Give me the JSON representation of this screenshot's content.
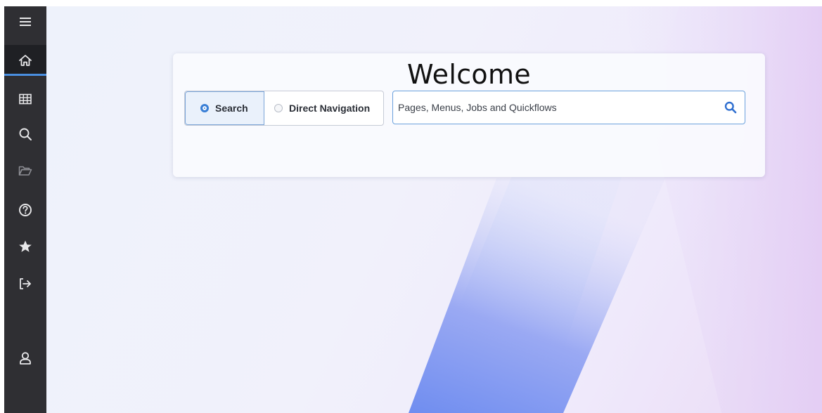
{
  "sidebar": {
    "items": [
      {
        "id": "menu",
        "icon": "hamburger-menu-icon"
      },
      {
        "id": "home",
        "icon": "home-icon",
        "active": true
      },
      {
        "id": "dashboard",
        "icon": "grid-icon"
      },
      {
        "id": "search",
        "icon": "search-icon"
      },
      {
        "id": "files",
        "icon": "folder-icon"
      },
      {
        "id": "help",
        "icon": "help-icon"
      },
      {
        "id": "favorites",
        "icon": "star-icon"
      },
      {
        "id": "sign-out",
        "icon": "sign-out-icon"
      },
      {
        "id": "profile",
        "icon": "user-icon"
      }
    ],
    "background": "#2f2f33",
    "active_indicator": "#4a8fe0"
  },
  "welcome": {
    "title": "Welcome"
  },
  "mode_toggle": {
    "options": [
      {
        "label": "Search",
        "selected": true
      },
      {
        "label": "Direct Navigation",
        "selected": false
      }
    ]
  },
  "search": {
    "placeholder": "Pages, Menus, Jobs and Quickflows",
    "value": "",
    "button_icon": "search-icon"
  },
  "colors": {
    "accent": "#3a7fd6",
    "background_shape": "#7f99f0"
  }
}
